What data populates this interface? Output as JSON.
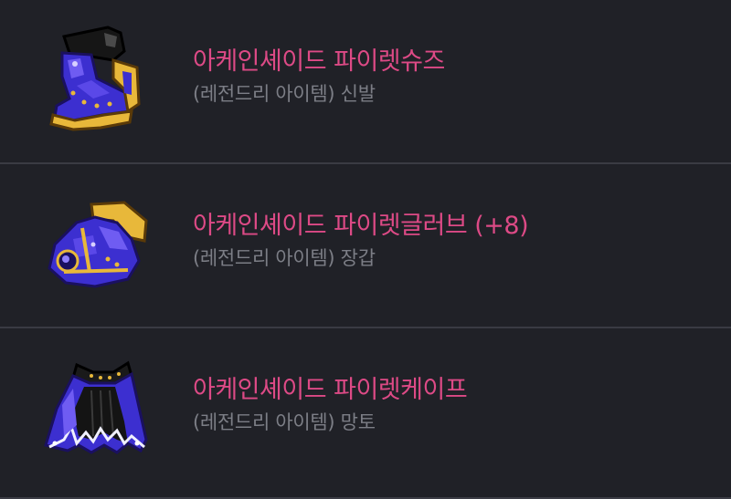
{
  "items": [
    {
      "icon": "arcane-shoes-icon",
      "name": "아케인셰이드 파이렛슈즈",
      "subtitle": "(레전드리 아이템) 신발"
    },
    {
      "icon": "arcane-gloves-icon",
      "name": "아케인셰이드 파이렛글러브 (+8)",
      "subtitle": "(레전드리 아이템) 장갑"
    },
    {
      "icon": "arcane-cape-icon",
      "name": "아케인셰이드 파이렛케이프",
      "subtitle": "(레전드리 아이템) 망토"
    }
  ],
  "colors": {
    "background": "#202127",
    "divider": "#3a3b43",
    "name_text": "#dd4a86",
    "subtitle_text": "#7c7e86",
    "item_purple": "#3c2fd0",
    "item_gold": "#e8b83a"
  }
}
